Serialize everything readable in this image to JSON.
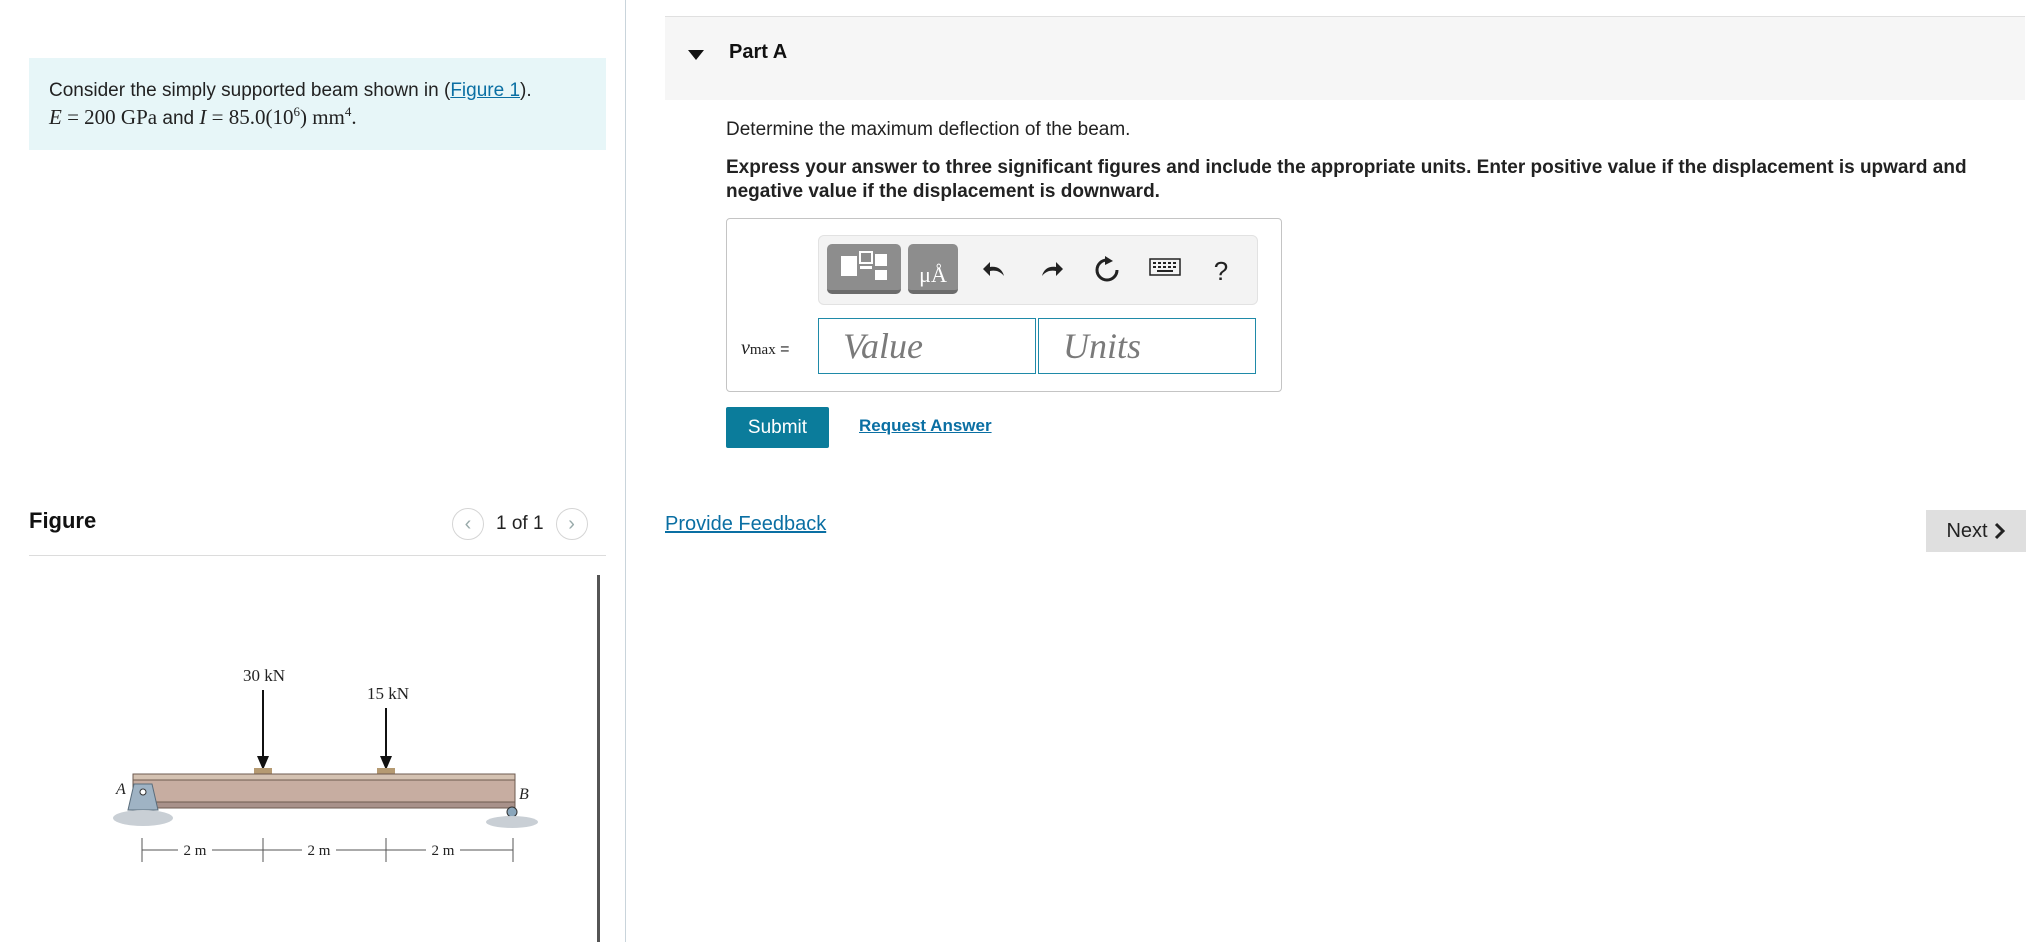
{
  "problem": {
    "text_before_link": "Consider the simply supported beam shown in (",
    "link_text": "Figure 1",
    "text_after_link": ").",
    "math_line": {
      "E_sym": "E",
      "E_val": " = 200 GPa",
      "and_text": "and",
      "I_sym": "I",
      "I_val": " = 85.0(10",
      "I_exp": "6",
      "I_close": ") mm",
      "I_unit_exp": "4",
      "period": "."
    }
  },
  "figure": {
    "title": "Figure",
    "page_indicator": "1 of 1",
    "prev_glyph": "‹",
    "next_glyph": "›",
    "load1": "30 kN",
    "load2": "15 kN",
    "support_a": "A",
    "support_b": "B",
    "dim1": "2 m",
    "dim2": "2 m",
    "dim3": "2 m"
  },
  "part": {
    "title": "Part A",
    "question": "Determine the maximum deflection of the beam.",
    "instructions": "Express your answer to three significant figures and include the appropriate units. Enter positive value if the displacement is upward and negative value if the displacement is downward.",
    "variable_symbol": "v",
    "variable_subscript": "max",
    "equals": " =",
    "value_placeholder": "Value",
    "units_placeholder": "Units",
    "toolbar": {
      "units_glyph": "μÅ",
      "help_glyph": "?"
    },
    "submit_label": "Submit",
    "request_answer_label": "Request Answer"
  },
  "footer": {
    "feedback_label": "Provide Feedback",
    "next_label": "Next"
  }
}
